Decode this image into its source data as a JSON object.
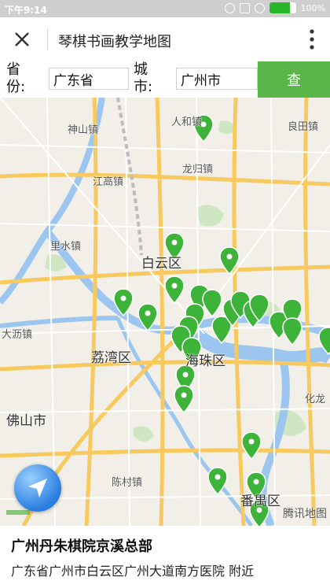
{
  "status_bar": {
    "time": "下午9:14",
    "battery": "100%"
  },
  "header": {
    "title": "琴棋书画教学地图"
  },
  "search": {
    "province_label": "省份:",
    "province_value": "广东省",
    "city_label": "城市:",
    "city_value": "广州市",
    "button_label": "查"
  },
  "map": {
    "places": [
      {
        "id": "renhe",
        "name": "人和镇"
      },
      {
        "id": "shenshan",
        "name": "神山镇"
      },
      {
        "id": "liangtian",
        "name": "良田镇"
      },
      {
        "id": "jianggao",
        "name": "江高镇"
      },
      {
        "id": "longgui",
        "name": "龙归镇"
      },
      {
        "id": "lishui",
        "name": "里水镇"
      },
      {
        "id": "baiyun",
        "name": "白云区"
      },
      {
        "id": "dali",
        "name": "大沥镇"
      },
      {
        "id": "liwan",
        "name": "荔湾区"
      },
      {
        "id": "haizhu",
        "name": "海珠区"
      },
      {
        "id": "foshan",
        "name": "佛山市"
      },
      {
        "id": "chencun",
        "name": "陈村镇"
      },
      {
        "id": "panyu",
        "name": "番禺区"
      },
      {
        "id": "hua",
        "name": "化龙"
      }
    ],
    "attribution": "腾讯地图",
    "marker_color": "#3db33a"
  },
  "info": {
    "name": "广州丹朱棋院京溪总部",
    "address": "广东省广州市白云区广州大道南方医院 附近"
  }
}
